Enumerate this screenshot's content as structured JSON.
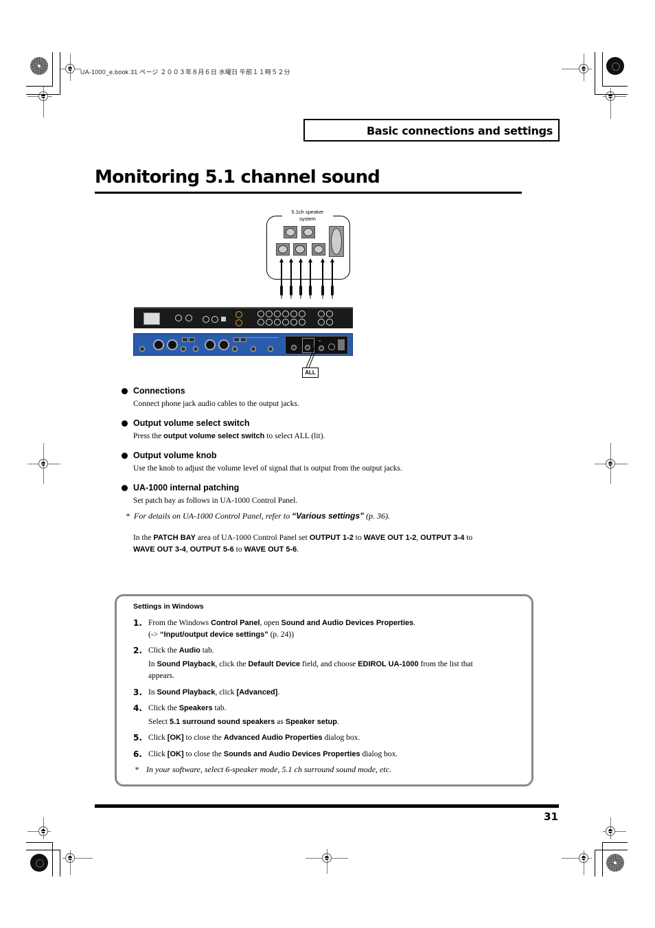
{
  "print_header": {
    "meta": "UA-1000_e.book  31 ページ  ２００３年８月６日  水曜日  午前１１時５２分"
  },
  "section": {
    "title": "Basic connections and settings"
  },
  "page": {
    "title": "Monitoring 5.1 channel sound",
    "number": "31"
  },
  "diagram": {
    "speaker_label_line1": "5.1ch speaker",
    "speaker_label_line2": "system",
    "all_label": "ALL",
    "panel_colors": {
      "rear": "#1a1a1a",
      "front": "#2b5cab",
      "led": "#e02020"
    }
  },
  "bullets": [
    {
      "heading": "Connections",
      "text": "Connect phone jack audio cables to the output jacks."
    },
    {
      "heading": "Output volume select switch",
      "text_pre": "Press the ",
      "text_bold": "output volume select switch",
      "text_post": " to select ALL (lit)."
    },
    {
      "heading": "Output volume knob",
      "text": "Use the knob to adjust the volume level of signal that is output from the output jacks."
    },
    {
      "heading": "UA-1000 internal patching",
      "text": "Set patch bay as follows in UA-1000 Control Panel."
    }
  ],
  "note": {
    "marker": "*",
    "pre": "For details on UA-1000 Control Panel, refer to ",
    "link": "“Various settings”",
    "post": " (p. 36)."
  },
  "patch": {
    "t1": "In the ",
    "b1": "PATCH BAY",
    "t2": " area of UA-1000 Control Panel set ",
    "b2": "OUTPUT 1-2",
    "t3": " to ",
    "b3": "WAVE OUT 1-2",
    "t4": ", ",
    "b4": "OUTPUT 3-4",
    "t5": " to",
    "b5": "WAVE OUT 3-4",
    "t6": ", ",
    "b6": "OUTPUT 5-6",
    "t7": " to ",
    "b7": "WAVE OUT 5-6",
    "t8": "."
  },
  "settings": {
    "title": "Settings in Windows",
    "steps": [
      {
        "num": "1.",
        "l1": {
          "t1": "From the Windows ",
          "b1": "Control Panel",
          "t2": ", open ",
          "b2": "Sound and Audio Devices Properties",
          "t3": "."
        },
        "l2": {
          "t1": "(-> ",
          "b1": "“Input/output device settings”",
          "t2": " (p. 24))"
        }
      },
      {
        "num": "2.",
        "l1": {
          "t1": "Click the ",
          "b1": "Audio",
          "t2": " tab."
        },
        "l2": {
          "t1": "In ",
          "b1": "Sound Playback",
          "t2": ", click the ",
          "b2": "Default Device",
          "t3": " field, and choose ",
          "b3": "EDIROL UA-1000",
          "t4": " from the list that"
        },
        "l3": "appears."
      },
      {
        "num": "3.",
        "l1": {
          "t1": "In ",
          "b1": "Sound Playback",
          "t2": ", click ",
          "b2": "[Advanced]",
          "t3": "."
        }
      },
      {
        "num": "4.",
        "l1": {
          "t1": "Click the ",
          "b1": "Speakers",
          "t2": " tab."
        },
        "l2": {
          "t1": "Select ",
          "b1": "5.1 surround sound speakers",
          "t2": " as ",
          "b2": "Speaker setup",
          "t3": "."
        }
      },
      {
        "num": "5.",
        "l1": {
          "t1": "Click ",
          "b1": "[OK]",
          "t2": " to close the ",
          "b2": "Advanced Audio Properties",
          "t3": " dialog box."
        }
      },
      {
        "num": "6.",
        "l1": {
          "t1": "Click ",
          "b1": "[OK]",
          "t2": " to close the ",
          "b2": "Sounds and Audio Devices Properties",
          "t3": " dialog box."
        }
      }
    ],
    "note_marker": "*",
    "note": "In your software, select 6-speaker mode, 5.1 ch surround sound mode, etc."
  }
}
